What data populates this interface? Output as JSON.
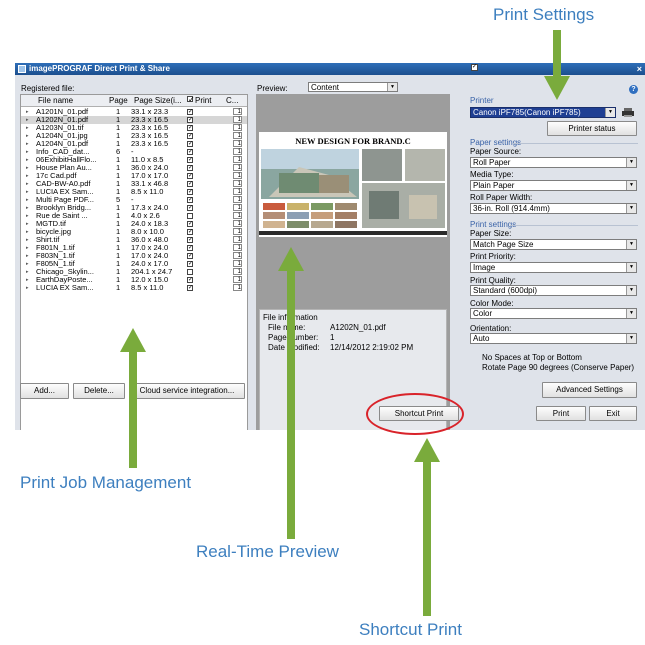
{
  "callouts": {
    "print_settings": "Print Settings",
    "job_management": "Print Job Management",
    "realtime_preview": "Real-Time Preview",
    "shortcut_print": "Shortcut Print"
  },
  "colors": {
    "callout_text": "#3d7fbf",
    "arrow": "#7aab3c",
    "highlight": "#d9232a",
    "title_bar": "#1c4f8e"
  },
  "window": {
    "title": "imagePROGRAF Direct Print & Share",
    "close": "×",
    "help_icon": "?"
  },
  "left": {
    "registered_label": "Registered file:",
    "columns": {
      "name": "File name",
      "page": "Page",
      "size": "Page Size(i...",
      "print": "Print",
      "copies": "C..."
    },
    "files": [
      {
        "name": "A1201N_01.pdf",
        "page": "1",
        "size": "33.1 x 23.3",
        "print": true,
        "copies": "1",
        "selected": false
      },
      {
        "name": "A1202N_01.pdf",
        "page": "1",
        "size": "23.3 x 16.5",
        "print": true,
        "copies": "1",
        "selected": true
      },
      {
        "name": "A1203N_01.tif",
        "page": "1",
        "size": "23.3 x 16.5",
        "print": true,
        "copies": "1",
        "selected": false
      },
      {
        "name": "A1204N_01.jpg",
        "page": "1",
        "size": "23.3 x 16.5",
        "print": true,
        "copies": "1",
        "selected": false
      },
      {
        "name": "A1204N_01.pdf",
        "page": "1",
        "size": "23.3 x 16.5",
        "print": true,
        "copies": "1",
        "selected": false
      },
      {
        "name": "Info_CAD_dat...",
        "page": "6",
        "size": "-",
        "print": true,
        "copies": "1",
        "selected": false
      },
      {
        "name": "06ExhibitHallFlo...",
        "page": "1",
        "size": "11.0 x 8.5",
        "print": true,
        "copies": "1",
        "selected": false
      },
      {
        "name": "House Plan Au...",
        "page": "1",
        "size": "36.0 x 24.0",
        "print": true,
        "copies": "1",
        "selected": false
      },
      {
        "name": "17c Cad.pdf",
        "page": "1",
        "size": "17.0 x 17.0",
        "print": true,
        "copies": "1",
        "selected": false
      },
      {
        "name": "CAD-BW-A0.pdf",
        "page": "1",
        "size": "33.1 x 46.8",
        "print": true,
        "copies": "1",
        "selected": false
      },
      {
        "name": "LUCIA EX Sam...",
        "page": "1",
        "size": "8.5 x 11.0",
        "print": true,
        "copies": "1",
        "selected": false
      },
      {
        "name": "Multi Page PDF...",
        "page": "5",
        "size": "-",
        "print": true,
        "copies": "1",
        "selected": false
      },
      {
        "name": "Brooklyn Bridg...",
        "page": "1",
        "size": "17.3 x 24.0",
        "print": true,
        "copies": "1",
        "selected": false
      },
      {
        "name": "Rue de Saint ...",
        "page": "1",
        "size": "4.0 x 2.6",
        "print": false,
        "copies": "1",
        "selected": false
      },
      {
        "name": "MGTD.tif",
        "page": "1",
        "size": "24.0 x 18.3",
        "print": true,
        "copies": "1",
        "selected": false
      },
      {
        "name": "bicycle.jpg",
        "page": "1",
        "size": "8.0 x 10.0",
        "print": true,
        "copies": "1",
        "selected": false
      },
      {
        "name": "Shirt.tif",
        "page": "1",
        "size": "36.0 x 48.0",
        "print": true,
        "copies": "1",
        "selected": false
      },
      {
        "name": "F801N_1.tif",
        "page": "1",
        "size": "17.0 x 24.0",
        "print": true,
        "copies": "1",
        "selected": false
      },
      {
        "name": "F803N_1.tif",
        "page": "1",
        "size": "17.0 x 24.0",
        "print": true,
        "copies": "1",
        "selected": false
      },
      {
        "name": "F805N_1.tif",
        "page": "1",
        "size": "24.0 x 17.0",
        "print": true,
        "copies": "1",
        "selected": false
      },
      {
        "name": "Chicago_Skylin...",
        "page": "1",
        "size": "204.1 x 24.7",
        "print": false,
        "copies": "1",
        "selected": false
      },
      {
        "name": "EarthDayPoste...",
        "page": "1",
        "size": "12.0 x 15.0",
        "print": true,
        "copies": "1",
        "selected": false
      },
      {
        "name": "LUCIA EX Sam...",
        "page": "1",
        "size": "8.5 x 11.0",
        "print": true,
        "copies": "1",
        "selected": false
      }
    ],
    "buttons": {
      "add": "Add...",
      "delete": "Delete...",
      "cloud": "Cloud service integration..."
    }
  },
  "preview": {
    "label": "Preview:",
    "mode": "Content",
    "page_title": "NEW DESIGN FOR BRAND.C",
    "file_info": {
      "heading": "File information",
      "name_label": "File name:",
      "name_value": "A1202N_01.pdf",
      "page_label": "Page number:",
      "page_value": "1",
      "date_label": "Date modified:",
      "date_value": "12/14/2012 2:19:02 PM"
    }
  },
  "right": {
    "printer_heading": "Printer",
    "printer_value": "Canon iPF785(Canon iPF785)",
    "printer_status": "Printer status",
    "paper_settings": "Paper settings",
    "paper_source_label": "Paper Source:",
    "paper_source": "Roll Paper",
    "media_type_label": "Media Type:",
    "media_type": "Plain Paper",
    "roll_width_label": "Roll Paper Width:",
    "roll_width": "36-in. Roll (914.4mm)",
    "print_settings": "Print settings",
    "paper_size_label": "Paper Size:",
    "paper_size": "Match Page Size",
    "priority_label": "Print Priority:",
    "priority": "Image",
    "quality_label": "Print Quality:",
    "quality": "Standard (600dpi)",
    "color_label": "Color Mode:",
    "color": "Color",
    "orientation_label": "Orientation:",
    "orientation": "Auto",
    "no_spaces": "No Spaces at Top or Bottom",
    "no_spaces_checked": false,
    "rotate": "Rotate Page 90 degrees (Conserve Paper)",
    "rotate_checked": true,
    "advanced": "Advanced Settings"
  },
  "bottom": {
    "shortcut": "Shortcut Print",
    "print": "Print",
    "exit": "Exit"
  }
}
